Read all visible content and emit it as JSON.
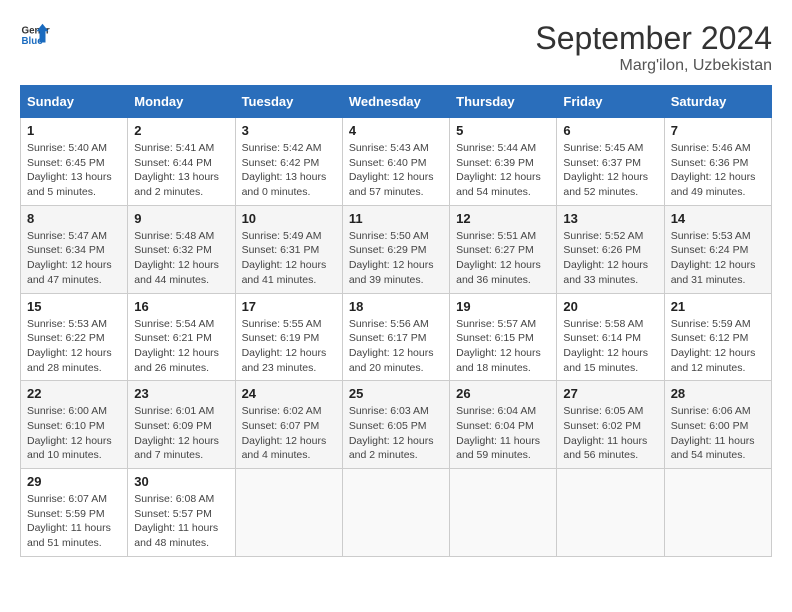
{
  "header": {
    "logo_line1": "General",
    "logo_line2": "Blue",
    "month": "September 2024",
    "location": "Marg'ilon, Uzbekistan"
  },
  "weekdays": [
    "Sunday",
    "Monday",
    "Tuesday",
    "Wednesday",
    "Thursday",
    "Friday",
    "Saturday"
  ],
  "weeks": [
    [
      {
        "day": "1",
        "sunrise": "Sunrise: 5:40 AM",
        "sunset": "Sunset: 6:45 PM",
        "daylight": "Daylight: 13 hours and 5 minutes."
      },
      {
        "day": "2",
        "sunrise": "Sunrise: 5:41 AM",
        "sunset": "Sunset: 6:44 PM",
        "daylight": "Daylight: 13 hours and 2 minutes."
      },
      {
        "day": "3",
        "sunrise": "Sunrise: 5:42 AM",
        "sunset": "Sunset: 6:42 PM",
        "daylight": "Daylight: 13 hours and 0 minutes."
      },
      {
        "day": "4",
        "sunrise": "Sunrise: 5:43 AM",
        "sunset": "Sunset: 6:40 PM",
        "daylight": "Daylight: 12 hours and 57 minutes."
      },
      {
        "day": "5",
        "sunrise": "Sunrise: 5:44 AM",
        "sunset": "Sunset: 6:39 PM",
        "daylight": "Daylight: 12 hours and 54 minutes."
      },
      {
        "day": "6",
        "sunrise": "Sunrise: 5:45 AM",
        "sunset": "Sunset: 6:37 PM",
        "daylight": "Daylight: 12 hours and 52 minutes."
      },
      {
        "day": "7",
        "sunrise": "Sunrise: 5:46 AM",
        "sunset": "Sunset: 6:36 PM",
        "daylight": "Daylight: 12 hours and 49 minutes."
      }
    ],
    [
      {
        "day": "8",
        "sunrise": "Sunrise: 5:47 AM",
        "sunset": "Sunset: 6:34 PM",
        "daylight": "Daylight: 12 hours and 47 minutes."
      },
      {
        "day": "9",
        "sunrise": "Sunrise: 5:48 AM",
        "sunset": "Sunset: 6:32 PM",
        "daylight": "Daylight: 12 hours and 44 minutes."
      },
      {
        "day": "10",
        "sunrise": "Sunrise: 5:49 AM",
        "sunset": "Sunset: 6:31 PM",
        "daylight": "Daylight: 12 hours and 41 minutes."
      },
      {
        "day": "11",
        "sunrise": "Sunrise: 5:50 AM",
        "sunset": "Sunset: 6:29 PM",
        "daylight": "Daylight: 12 hours and 39 minutes."
      },
      {
        "day": "12",
        "sunrise": "Sunrise: 5:51 AM",
        "sunset": "Sunset: 6:27 PM",
        "daylight": "Daylight: 12 hours and 36 minutes."
      },
      {
        "day": "13",
        "sunrise": "Sunrise: 5:52 AM",
        "sunset": "Sunset: 6:26 PM",
        "daylight": "Daylight: 12 hours and 33 minutes."
      },
      {
        "day": "14",
        "sunrise": "Sunrise: 5:53 AM",
        "sunset": "Sunset: 6:24 PM",
        "daylight": "Daylight: 12 hours and 31 minutes."
      }
    ],
    [
      {
        "day": "15",
        "sunrise": "Sunrise: 5:53 AM",
        "sunset": "Sunset: 6:22 PM",
        "daylight": "Daylight: 12 hours and 28 minutes."
      },
      {
        "day": "16",
        "sunrise": "Sunrise: 5:54 AM",
        "sunset": "Sunset: 6:21 PM",
        "daylight": "Daylight: 12 hours and 26 minutes."
      },
      {
        "day": "17",
        "sunrise": "Sunrise: 5:55 AM",
        "sunset": "Sunset: 6:19 PM",
        "daylight": "Daylight: 12 hours and 23 minutes."
      },
      {
        "day": "18",
        "sunrise": "Sunrise: 5:56 AM",
        "sunset": "Sunset: 6:17 PM",
        "daylight": "Daylight: 12 hours and 20 minutes."
      },
      {
        "day": "19",
        "sunrise": "Sunrise: 5:57 AM",
        "sunset": "Sunset: 6:15 PM",
        "daylight": "Daylight: 12 hours and 18 minutes."
      },
      {
        "day": "20",
        "sunrise": "Sunrise: 5:58 AM",
        "sunset": "Sunset: 6:14 PM",
        "daylight": "Daylight: 12 hours and 15 minutes."
      },
      {
        "day": "21",
        "sunrise": "Sunrise: 5:59 AM",
        "sunset": "Sunset: 6:12 PM",
        "daylight": "Daylight: 12 hours and 12 minutes."
      }
    ],
    [
      {
        "day": "22",
        "sunrise": "Sunrise: 6:00 AM",
        "sunset": "Sunset: 6:10 PM",
        "daylight": "Daylight: 12 hours and 10 minutes."
      },
      {
        "day": "23",
        "sunrise": "Sunrise: 6:01 AM",
        "sunset": "Sunset: 6:09 PM",
        "daylight": "Daylight: 12 hours and 7 minutes."
      },
      {
        "day": "24",
        "sunrise": "Sunrise: 6:02 AM",
        "sunset": "Sunset: 6:07 PM",
        "daylight": "Daylight: 12 hours and 4 minutes."
      },
      {
        "day": "25",
        "sunrise": "Sunrise: 6:03 AM",
        "sunset": "Sunset: 6:05 PM",
        "daylight": "Daylight: 12 hours and 2 minutes."
      },
      {
        "day": "26",
        "sunrise": "Sunrise: 6:04 AM",
        "sunset": "Sunset: 6:04 PM",
        "daylight": "Daylight: 11 hours and 59 minutes."
      },
      {
        "day": "27",
        "sunrise": "Sunrise: 6:05 AM",
        "sunset": "Sunset: 6:02 PM",
        "daylight": "Daylight: 11 hours and 56 minutes."
      },
      {
        "day": "28",
        "sunrise": "Sunrise: 6:06 AM",
        "sunset": "Sunset: 6:00 PM",
        "daylight": "Daylight: 11 hours and 54 minutes."
      }
    ],
    [
      {
        "day": "29",
        "sunrise": "Sunrise: 6:07 AM",
        "sunset": "Sunset: 5:59 PM",
        "daylight": "Daylight: 11 hours and 51 minutes."
      },
      {
        "day": "30",
        "sunrise": "Sunrise: 6:08 AM",
        "sunset": "Sunset: 5:57 PM",
        "daylight": "Daylight: 11 hours and 48 minutes."
      },
      null,
      null,
      null,
      null,
      null
    ]
  ]
}
